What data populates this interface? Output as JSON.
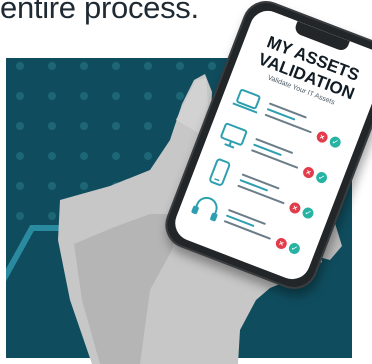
{
  "caption": "entire process.",
  "app": {
    "title_line1": "MY ASSETS",
    "title_line2": "VALIDATION",
    "subtitle": "Validate Your IT Assets"
  },
  "assets": [
    {
      "icon": "laptop-icon"
    },
    {
      "icon": "monitor-icon"
    },
    {
      "icon": "smartphone-icon"
    },
    {
      "icon": "headphones-icon"
    }
  ],
  "status_icons": {
    "fail": "close-icon",
    "pass": "check-icon"
  },
  "colors": {
    "panel": "#0f4d5e",
    "dots": "#1d6676",
    "accent_line": "#2d9fb0",
    "fail": "#e23b4a",
    "pass": "#27b3a3",
    "highlight": "#9bd64a"
  }
}
